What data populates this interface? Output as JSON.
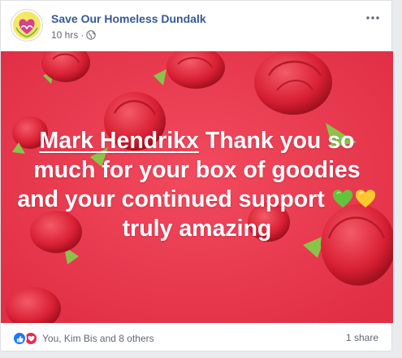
{
  "post": {
    "page_name": "Save Our Homeless Dundalk",
    "time": "10 hrs",
    "separator": "·",
    "privacy_icon": "globe-icon",
    "menu_icon": "more-options-icon",
    "mention": "Mark Hendrikx",
    "text_before_emoji": "Thank you so much for your box of goodies and your continued support",
    "emojis": [
      "green-heart-icon",
      "yellow-heart-icon"
    ],
    "text_after_emoji": "truly amazing",
    "background_color": "#ea3b50"
  },
  "footer": {
    "reaction_icons": [
      "like-icon",
      "love-icon"
    ],
    "reactions_text": "You, Kim Bis and 8 others",
    "shares_text": "1 share"
  }
}
